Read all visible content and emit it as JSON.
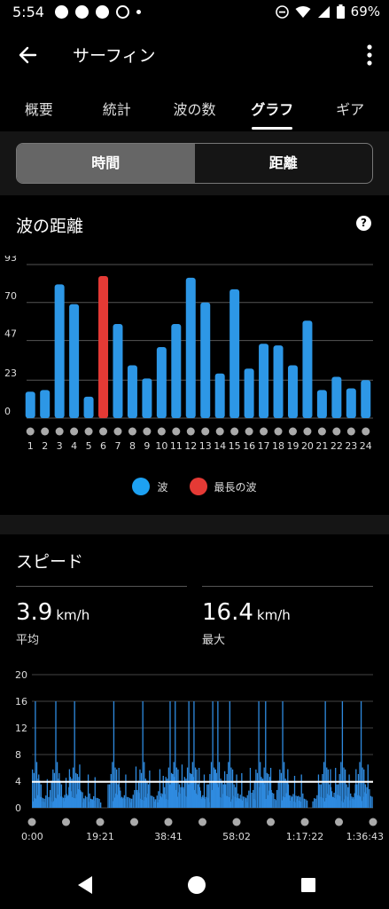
{
  "status_bar": {
    "time": "5:54",
    "battery": "69%"
  },
  "app_bar": {
    "title": "サーフィン"
  },
  "tabs": [
    {
      "label": "概要"
    },
    {
      "label": "統計"
    },
    {
      "label": "波の数"
    },
    {
      "label": "グラフ"
    },
    {
      "label": "ギア"
    }
  ],
  "active_tab": 3,
  "segmented": {
    "time_label": "時間",
    "distance_label": "距離",
    "selected": "時間"
  },
  "wave_distance": {
    "title": "波の距離",
    "legend": {
      "wave": "波",
      "longest_wave": "最長の波"
    }
  },
  "speed": {
    "title": "スピード",
    "average": {
      "value": "3.9",
      "unit": "km/h",
      "label": "平均"
    },
    "max": {
      "value": "16.4",
      "unit": "km/h",
      "label": "最大"
    }
  },
  "colors": {
    "bar": "#2d97e6",
    "longest": "#e53a35",
    "speed_fill": "#2f8be0",
    "avg_line": "#ffffff"
  },
  "chart_data": [
    {
      "type": "bar",
      "title": "波の距離",
      "categories": [
        "1",
        "2",
        "3",
        "4",
        "5",
        "6",
        "7",
        "8",
        "9",
        "10",
        "11",
        "12",
        "13",
        "14",
        "15",
        "16",
        "17",
        "18",
        "19",
        "20",
        "21",
        "22",
        "23",
        "24"
      ],
      "series": [
        {
          "name": "波",
          "values": [
            16,
            17,
            81,
            69,
            13,
            0,
            57,
            32,
            24,
            43,
            57,
            85,
            70,
            27,
            78,
            30,
            45,
            44,
            32,
            59,
            17,
            25,
            18,
            23
          ]
        },
        {
          "name": "最長の波",
          "values": [
            0,
            0,
            0,
            0,
            0,
            86,
            0,
            0,
            0,
            0,
            0,
            0,
            0,
            0,
            0,
            0,
            0,
            0,
            0,
            0,
            0,
            0,
            0,
            0
          ]
        }
      ],
      "y_ticks": [
        "0",
        "23",
        "47",
        "70",
        "93"
      ],
      "ylim": [
        0,
        93
      ],
      "grid": true,
      "legend_position": "bottom"
    },
    {
      "type": "area",
      "title": "スピード",
      "x_ticks": [
        "0:00",
        "19:21",
        "38:41",
        "58:02",
        "1:17:22",
        "1:36:43"
      ],
      "y_ticks": [
        "0",
        "4",
        "8",
        "12",
        "16",
        "20"
      ],
      "ylim": [
        0,
        20
      ],
      "average_line": 3.9,
      "grid": true,
      "peaks": [
        {
          "t": 0.01,
          "v": 16.0
        },
        {
          "t": 0.02,
          "v": 5.0
        },
        {
          "t": 0.045,
          "v": 4.3
        },
        {
          "t": 0.07,
          "v": 16.0
        },
        {
          "t": 0.08,
          "v": 5.2
        },
        {
          "t": 0.1,
          "v": 4.5
        },
        {
          "t": 0.11,
          "v": 5.8
        },
        {
          "t": 0.125,
          "v": 16.0
        },
        {
          "t": 0.14,
          "v": 6.5
        },
        {
          "t": 0.165,
          "v": 5.0
        },
        {
          "t": 0.185,
          "v": 4.6
        },
        {
          "t": 0.24,
          "v": 16.0
        },
        {
          "t": 0.255,
          "v": 6.0
        },
        {
          "t": 0.275,
          "v": 5.0
        },
        {
          "t": 0.305,
          "v": 6.2
        },
        {
          "t": 0.325,
          "v": 16.0
        },
        {
          "t": 0.345,
          "v": 5.6
        },
        {
          "t": 0.375,
          "v": 5.8
        },
        {
          "t": 0.385,
          "v": 4.8
        },
        {
          "t": 0.405,
          "v": 16.0
        },
        {
          "t": 0.42,
          "v": 16.0
        },
        {
          "t": 0.44,
          "v": 6.5
        },
        {
          "t": 0.46,
          "v": 16.0
        },
        {
          "t": 0.475,
          "v": 16.0
        },
        {
          "t": 0.49,
          "v": 6.0
        },
        {
          "t": 0.505,
          "v": 5.0
        },
        {
          "t": 0.53,
          "v": 16.0
        },
        {
          "t": 0.545,
          "v": 16.0
        },
        {
          "t": 0.565,
          "v": 5.5
        },
        {
          "t": 0.58,
          "v": 16.0
        },
        {
          "t": 0.6,
          "v": 5.0
        },
        {
          "t": 0.615,
          "v": 5.2
        },
        {
          "t": 0.64,
          "v": 6.0
        },
        {
          "t": 0.665,
          "v": 16.0
        },
        {
          "t": 0.685,
          "v": 16.0
        },
        {
          "t": 0.7,
          "v": 6.0
        },
        {
          "t": 0.735,
          "v": 16.0
        },
        {
          "t": 0.75,
          "v": 5.8
        },
        {
          "t": 0.77,
          "v": 4.8
        },
        {
          "t": 0.79,
          "v": 5.0
        },
        {
          "t": 0.84,
          "v": 5.0
        },
        {
          "t": 0.86,
          "v": 16.0
        },
        {
          "t": 0.875,
          "v": 5.8
        },
        {
          "t": 0.89,
          "v": 6.0
        },
        {
          "t": 0.91,
          "v": 16.0
        },
        {
          "t": 0.93,
          "v": 5.0
        },
        {
          "t": 0.95,
          "v": 5.8
        },
        {
          "t": 0.965,
          "v": 16.0
        },
        {
          "t": 0.985,
          "v": 6.5
        }
      ]
    }
  ]
}
